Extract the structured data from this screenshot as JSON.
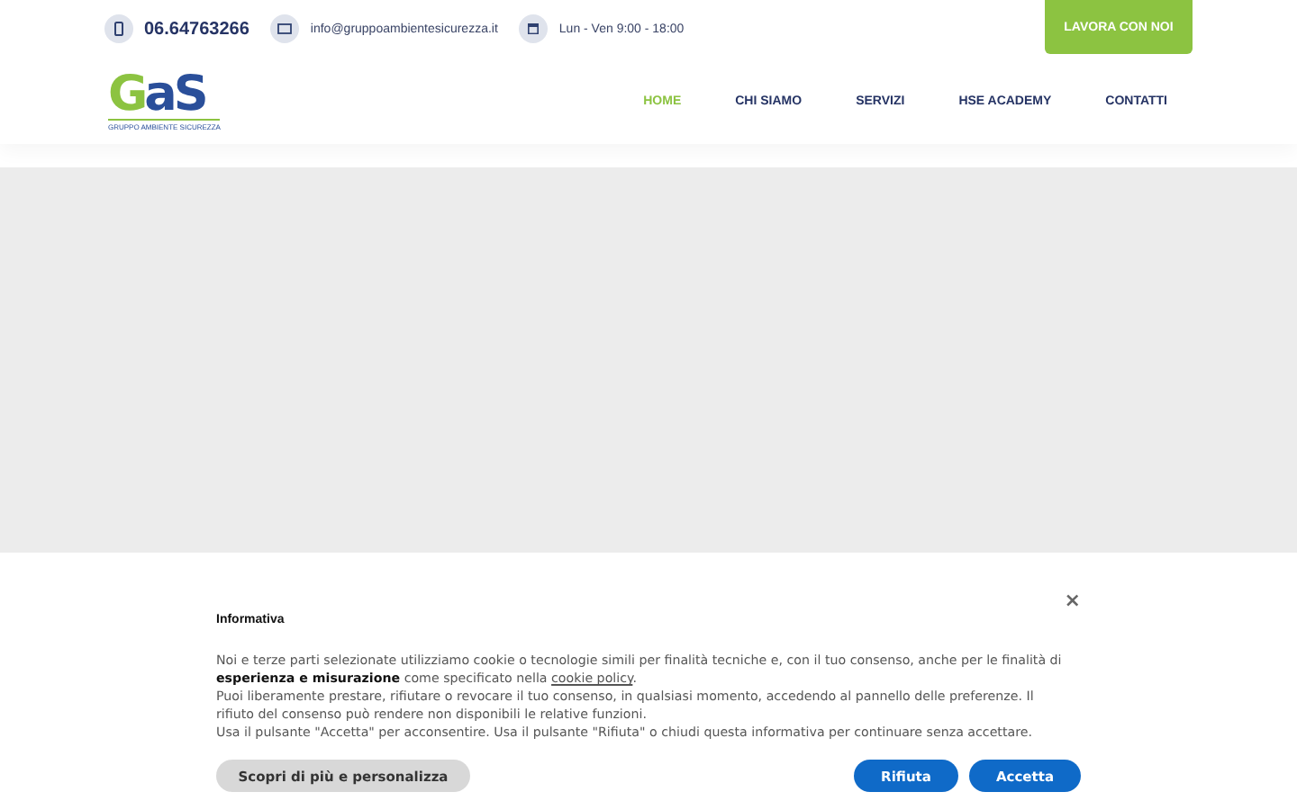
{
  "topbar": {
    "phone": "06.64763266",
    "email": "info@gruppoambientesicurezza.it",
    "hours": "Lun - Ven 9:00 - 18:00",
    "cta": "LAVORA CON NOI"
  },
  "logo": {
    "mark_first": "G",
    "mark_rest": "aS",
    "caption": "GRUPPO AMBIENTE SICUREZZA"
  },
  "nav": [
    {
      "label": "HOME",
      "selected": true
    },
    {
      "label": "CHI SIAMO",
      "selected": false
    },
    {
      "label": "SERVIZI",
      "selected": false
    },
    {
      "label": "HSE ACADEMY",
      "selected": false
    },
    {
      "label": "CONTATTI",
      "selected": false
    }
  ],
  "cookie_banner": {
    "title": "Informativa",
    "close": "×",
    "paragraphs": [
      {
        "text": "Noi e terze parti selezionate utilizziamo cookie o tecnologie simili per finalità tecniche e, con il tuo consenso, anche per le finalità di **esperienza e misurazione** come specificato nella",
        "link": "cookie policy",
        "after": "."
      },
      {
        "text": "Puoi liberamente prestare, rifiutare o revocare il tuo consenso, in qualsiasi momento, accedendo al pannello delle preferenze. Il rifiuto del consenso può rendere non disponibili le relative funzioni."
      },
      {
        "text": "Usa il pulsante \"Accetta\" per acconsentire. Usa il pulsante \"Rifiuta\" o chiudi questa informativa per continuare senza accettare."
      }
    ],
    "buttons": [
      {
        "label": "Scopri di più e personalizza",
        "kind": "secondary"
      },
      {
        "label": "Rifiuta",
        "kind": "primary"
      },
      {
        "label": "Accetta",
        "kind": "primary"
      }
    ]
  }
}
